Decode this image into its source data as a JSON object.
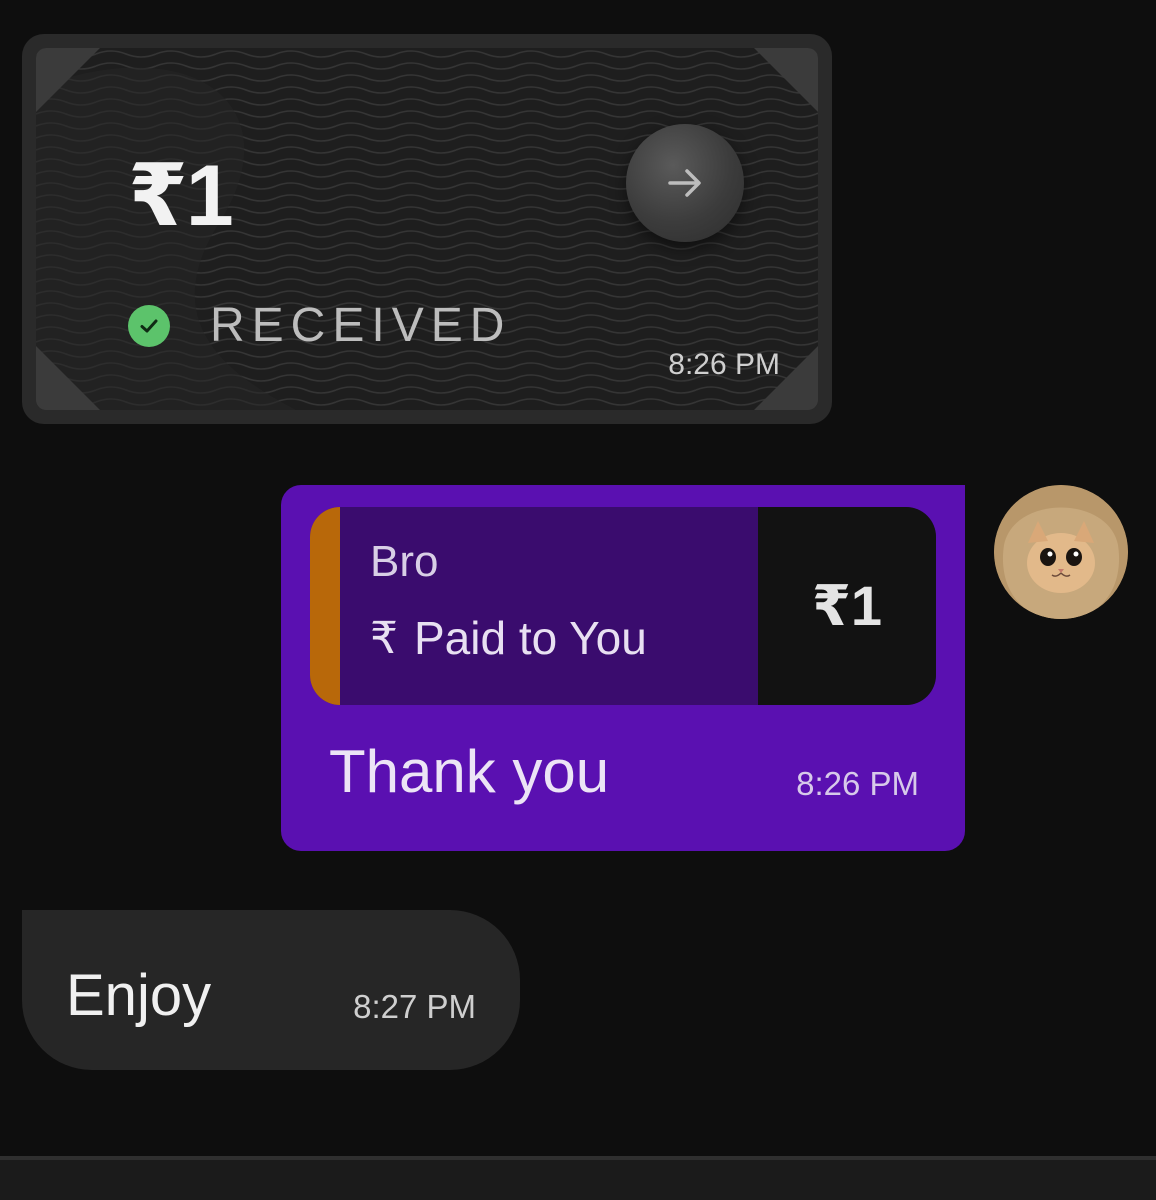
{
  "payment_card": {
    "amount": "₹1",
    "status": "RECEIVED",
    "time": "8:26 PM"
  },
  "sent_message": {
    "quote_name": "Bro",
    "quote_detail": "Paid to You",
    "quote_amount": "₹1",
    "text": "Thank you",
    "time": "8:26 PM"
  },
  "received_message": {
    "text": "Enjoy",
    "time": "8:27 PM"
  },
  "colors": {
    "sent_bubble": "#5a10b1",
    "quote_bar": "#b8680a",
    "received_check": "#5cc36b"
  }
}
